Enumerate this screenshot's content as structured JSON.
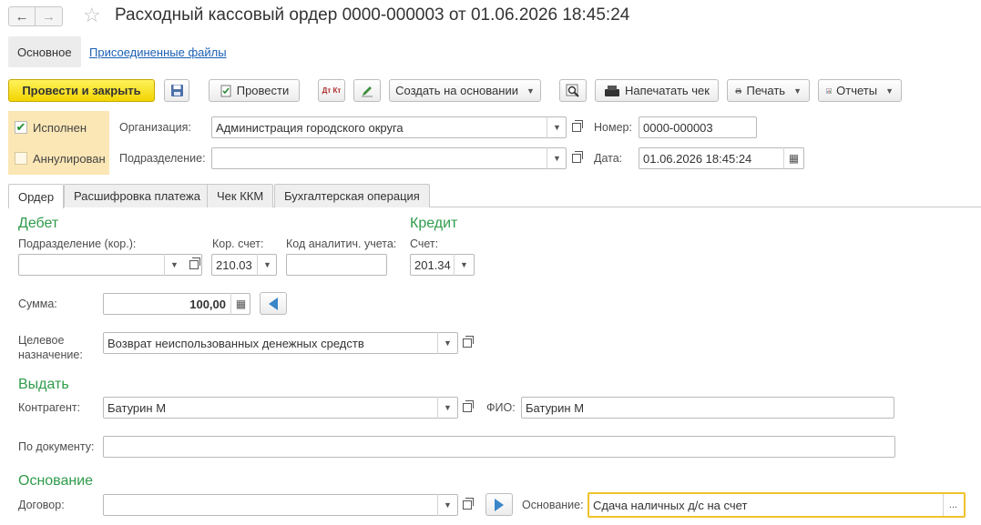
{
  "header": {
    "title": "Расходный кассовый ордер 0000-000003 от 01.06.2026 18:45:24",
    "back_icon": "←",
    "forward_icon": "→",
    "star_icon": "☆"
  },
  "subtabs": {
    "main": "Основное",
    "attached": "Присоединенные файлы"
  },
  "toolbar": {
    "post_close": "Провести и закрыть",
    "post": "Провести",
    "create_based": "Создать на основании",
    "print_receipt": "Напечатать чек",
    "print": "Печать",
    "reports": "Отчеты",
    "dt_kt": "Дт Кт"
  },
  "status": {
    "executed": "Исполнен",
    "annulled": "Аннулирован",
    "executed_checked": true,
    "annulled_checked": false
  },
  "form": {
    "org_label": "Организация:",
    "org_value": "Администрация городского округа",
    "dept_label": "Подразделение:",
    "dept_value": "",
    "number_label": "Номер:",
    "number_value": "0000-000003",
    "date_label": "Дата:",
    "date_value": "01.06.2026 18:45:24"
  },
  "tabs": [
    "Ордер",
    "Расшифровка платежа",
    "Чек ККМ",
    "Бухгалтерская операция"
  ],
  "order": {
    "debit_title": "Дебет",
    "credit_title": "Кредит",
    "corr_dept_label": "Подразделение (кор.):",
    "corr_dept_value": "",
    "corr_account_label": "Кор. счет:",
    "corr_account_value": "210.03",
    "analytic_code_label": "Код аналитич. учета:",
    "analytic_code_value": "",
    "account_label": "Счет:",
    "account_value": "201.34",
    "sum_label": "Сумма:",
    "sum_value": "100,00",
    "purpose_label_1": "Целевое",
    "purpose_label_2": "назначение:",
    "purpose_value": "Возврат неиспользованных денежных средств",
    "issue_title": "Выдать",
    "contractor_label": "Контрагент:",
    "contractor_value": "Батурин М",
    "fio_label": "ФИО:",
    "fio_value": "Батурин М",
    "by_doc_label": "По документу:",
    "by_doc_value": "",
    "basis_title": "Основание",
    "contract_label": "Договор:",
    "contract_value": "",
    "basis_label": "Основание:",
    "basis_value": "Сдача наличных д/с на счет",
    "ellipsis": "..."
  }
}
